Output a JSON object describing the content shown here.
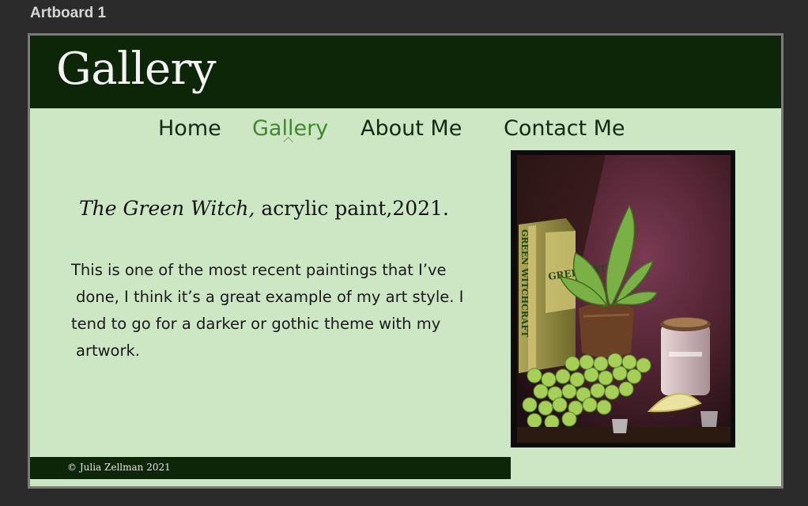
{
  "artboard": {
    "label": "Artboard 1"
  },
  "header": {
    "title": "Gallery"
  },
  "nav": {
    "items": [
      {
        "label": "Home"
      },
      {
        "label": "Gallery"
      },
      {
        "label": "About Me"
      },
      {
        "label": "Contact Me"
      }
    ],
    "active": "Gallery"
  },
  "artwork": {
    "title": "The Green Witch,",
    "details": " acrylic paint,2021.",
    "description_lines": [
      "This is one of the most recent paintings that I’ve",
      "done, I think it’s a great example of my art style. I",
      "tend to go for a darker or gothic theme with my",
      "artwork."
    ],
    "painting_text": {
      "spine": "GREEN WITCHCRAFT",
      "cover": "GREEN WITCH"
    }
  },
  "footer": {
    "copyright": "© Julia Zellman 2021"
  },
  "colors": {
    "dark_green": "#0c2607",
    "page_bg": "#cde6c4",
    "nav_active": "#3f8a2d",
    "canvas_bg": "#2b2b2b"
  }
}
